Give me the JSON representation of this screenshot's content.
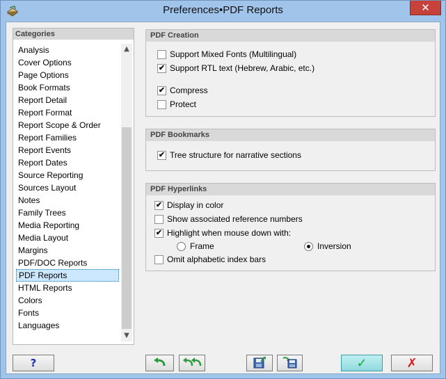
{
  "window": {
    "title": "Preferences•PDF Reports",
    "close_glyph": "✕"
  },
  "categories": {
    "header": "Categories",
    "items": [
      {
        "label": "Analysis"
      },
      {
        "label": "Cover Options"
      },
      {
        "label": "Page Options"
      },
      {
        "label": "Book Formats"
      },
      {
        "label": "Report Detail"
      },
      {
        "label": "Report Format"
      },
      {
        "label": "Report Scope & Order"
      },
      {
        "label": "Report Families"
      },
      {
        "label": "Report Events"
      },
      {
        "label": "Report Dates"
      },
      {
        "label": "Source Reporting"
      },
      {
        "label": "Sources Layout"
      },
      {
        "label": "Notes"
      },
      {
        "label": "Family Trees"
      },
      {
        "label": "Media Reporting"
      },
      {
        "label": "Media Layout"
      },
      {
        "label": "Margins"
      },
      {
        "label": "PDF/DOC Reports"
      },
      {
        "label": "PDF Reports",
        "selected": true
      },
      {
        "label": "HTML Reports"
      },
      {
        "label": "Colors"
      },
      {
        "label": "Fonts"
      },
      {
        "label": "Languages"
      }
    ],
    "scroll_up_glyph": "▲",
    "scroll_down_glyph": "▼"
  },
  "pdf_creation": {
    "header": "PDF Creation",
    "mixed_fonts": {
      "label": "Support Mixed Fonts (Multilingual)",
      "checked": false
    },
    "rtl_text": {
      "label": "Support RTL text (Hebrew, Arabic, etc.)",
      "checked": true
    },
    "compress": {
      "label": "Compress",
      "checked": true
    },
    "protect": {
      "label": "Protect",
      "checked": false
    }
  },
  "pdf_bookmarks": {
    "header": "PDF Bookmarks",
    "tree_structure": {
      "label": "Tree structure for narrative sections",
      "checked": true
    }
  },
  "pdf_hyperlinks": {
    "header": "PDF Hyperlinks",
    "display_color": {
      "label": "Display in color",
      "checked": true
    },
    "show_ref_numbers": {
      "label": "Show associated reference numbers",
      "checked": false
    },
    "highlight": {
      "label": "Highlight when mouse down with:",
      "checked": true
    },
    "frame": {
      "label": "Frame",
      "selected": false
    },
    "inversion": {
      "label": "Inversion",
      "selected": true
    },
    "omit_index_bars": {
      "label": "Omit alphabetic index bars",
      "checked": false
    }
  },
  "buttons": {
    "help": "?",
    "undo": "undo-arrow-icon",
    "undo_all": "undo-all-arrows-icon",
    "save": "save-disk-icon",
    "load": "load-disk-icon",
    "ok": "✓",
    "cancel": "✗"
  },
  "check_glyph": "✔",
  "colors": {
    "title_bar": "#a0c4ea",
    "close_button": "#c7423b",
    "selected_item": "#cce8ff",
    "ok_button": "#8fd9de",
    "accent_green": "#2a9a3a",
    "cancel_red": "#e01818"
  }
}
